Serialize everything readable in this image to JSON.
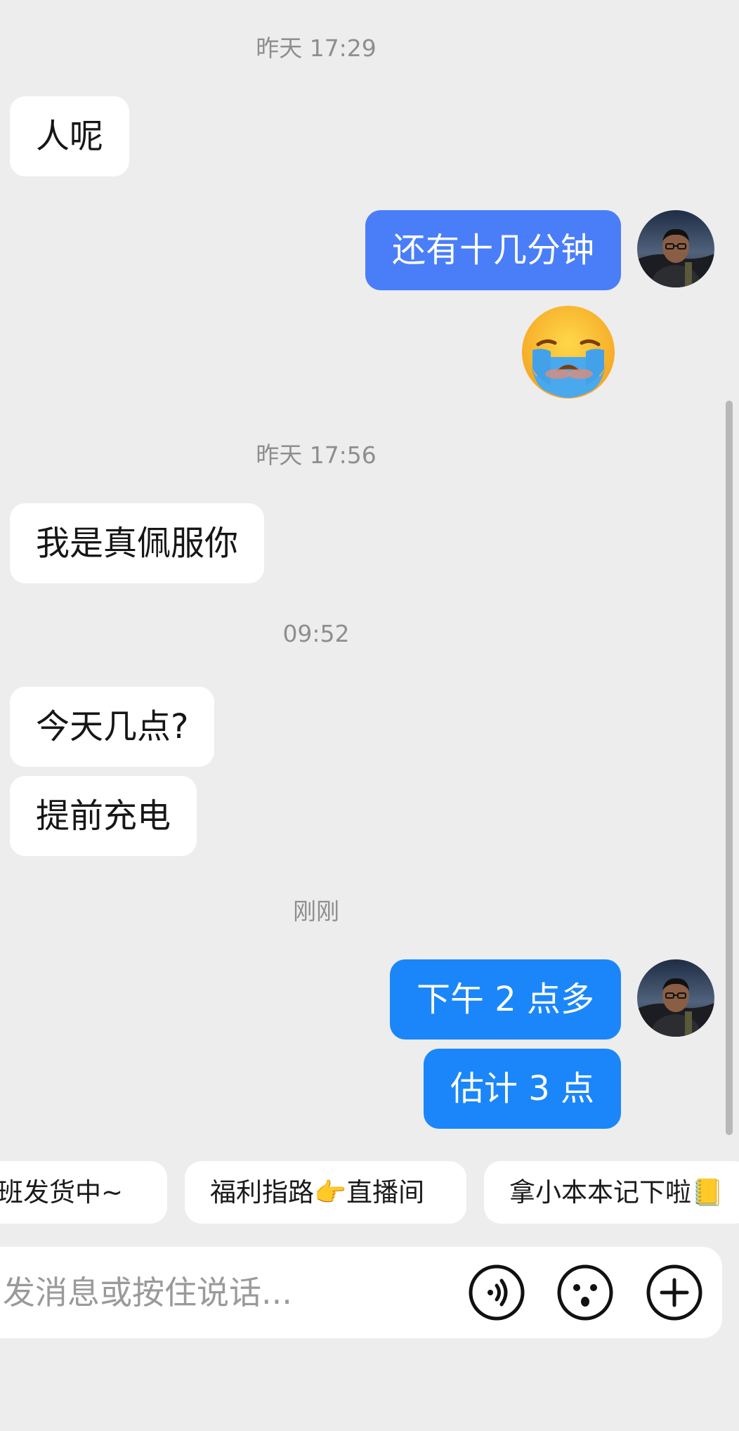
{
  "timestamps": {
    "t1": "昨天 17:29",
    "t2": "昨天 17:56",
    "t3": "09:52",
    "t4": "刚刚"
  },
  "messages": {
    "m1": "人呢",
    "m2": "还有十几分钟",
    "m3": "我是真佩服你",
    "m4": "今天几点?",
    "m5": "提前充电",
    "m6": "下午 2 点多",
    "m7": "估计 3 点"
  },
  "emoji_message": "crying-face",
  "quick_replies": {
    "r1": "班发货中~",
    "r2": "福利指路👉直播间",
    "r3": "拿小本本记下啦📒"
  },
  "input": {
    "placeholder": "发消息或按住说话..."
  },
  "colors": {
    "outgoing_blue_1": "#4a7ef8",
    "outgoing_blue_2": "#1b86fa",
    "incoming": "#ffffff",
    "background": "#ededed"
  }
}
